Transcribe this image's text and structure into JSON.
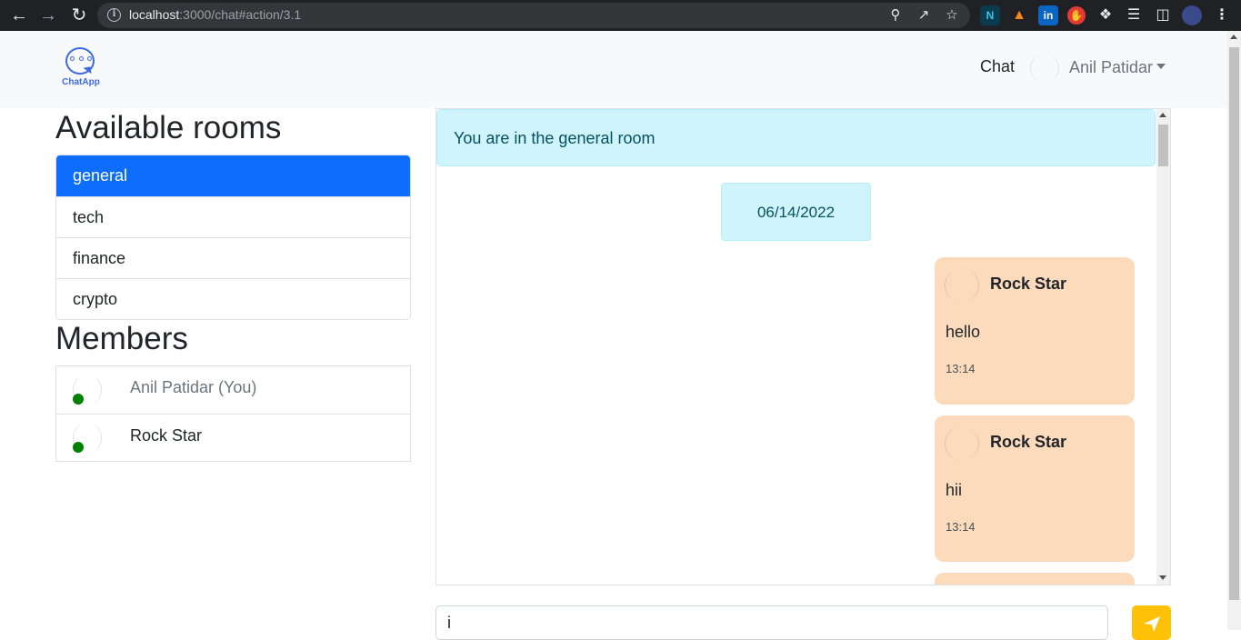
{
  "browser": {
    "url_host": "localhost",
    "url_rest": ":3000/chat#action/3.1"
  },
  "navbar": {
    "logo_label": "ChatApp",
    "chat_link": "Chat",
    "user_name": "Anil Patidar"
  },
  "sidebar": {
    "rooms_title": "Available rooms",
    "rooms": [
      {
        "label": "general",
        "active": true
      },
      {
        "label": "tech",
        "active": false
      },
      {
        "label": "finance",
        "active": false
      },
      {
        "label": "crypto",
        "active": false
      }
    ],
    "members_title": "Members",
    "members": [
      {
        "name": "Anil Patidar (You)",
        "status": "online"
      },
      {
        "name": "Rock Star",
        "status": "online"
      }
    ]
  },
  "chat": {
    "room_notice": "You are in the general room",
    "date": "06/14/2022",
    "messages": [
      {
        "author": "Rock Star",
        "text": "hello",
        "time": "13:14"
      },
      {
        "author": "Rock Star",
        "text": "hii",
        "time": "13:14"
      }
    ],
    "input_value": "i",
    "accent_color": "#ffc107",
    "message_bg": "#fcdbbd",
    "active_room_color": "#0d6efd"
  }
}
